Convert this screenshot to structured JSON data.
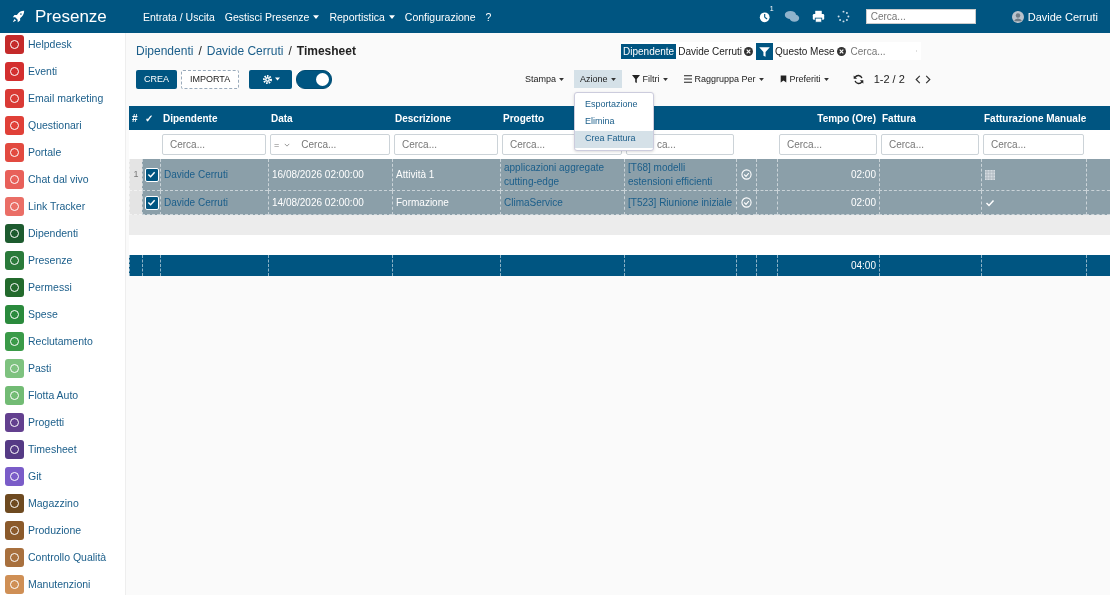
{
  "app": {
    "title": "Presenze",
    "menu": [
      {
        "label": "Entrata / Uscita",
        "dropdown": false
      },
      {
        "label": "Gestisci Presenze",
        "dropdown": true
      },
      {
        "label": "Reportistica",
        "dropdown": true
      },
      {
        "label": "Configurazione",
        "dropdown": false
      },
      {
        "label": "?",
        "dropdown": false
      }
    ],
    "notification_count": "1",
    "search": {
      "placeholder": "Cerca..."
    },
    "user": "Davide Cerruti"
  },
  "sidebar": {
    "items": [
      {
        "label": "Helpdesk",
        "color": "#c42a2a"
      },
      {
        "label": "Eventi",
        "color": "#d32f2f"
      },
      {
        "label": "Email marketing",
        "color": "#d93a35"
      },
      {
        "label": "Questionari",
        "color": "#e04038"
      },
      {
        "label": "Portale",
        "color": "#e24a40"
      },
      {
        "label": "Chat dal vivo",
        "color": "#e8605a"
      },
      {
        "label": "Link Tracker",
        "color": "#ea6e66"
      },
      {
        "label": "Dipendenti",
        "color": "#1d5b2f"
      },
      {
        "label": "Presenze",
        "color": "#2a7a3a"
      },
      {
        "label": "Permessi",
        "color": "#236a2c"
      },
      {
        "label": "Spese",
        "color": "#2a8a3c"
      },
      {
        "label": "Reclutamento",
        "color": "#3a9a48"
      },
      {
        "label": "Pasti",
        "color": "#7ec27f"
      },
      {
        "label": "Flotta Auto",
        "color": "#72bb74"
      },
      {
        "label": "Progetti",
        "color": "#63408f"
      },
      {
        "label": "Timesheet",
        "color": "#553a85"
      },
      {
        "label": "Git",
        "color": "#7a5cc8"
      },
      {
        "label": "Magazzino",
        "color": "#6e4a20"
      },
      {
        "label": "Produzione",
        "color": "#8b5a2b"
      },
      {
        "label": "Controllo Qualità",
        "color": "#a8703e"
      },
      {
        "label": "Manutenzioni",
        "color": "#cf8f55"
      }
    ]
  },
  "breadcrumb": {
    "separator": "/",
    "items": [
      {
        "label": "Dipendenti",
        "current": false
      },
      {
        "label": "Davide Cerruti",
        "current": false
      },
      {
        "label": "Timesheet",
        "current": true
      }
    ]
  },
  "buttons": {
    "create": "CREA",
    "import": "IMPORTA"
  },
  "view_toggle": {
    "on": true
  },
  "search": {
    "facets": [
      {
        "kind": "field",
        "field": "Dipendente",
        "value": "Davide Cerruti"
      },
      {
        "kind": "filter",
        "value": "Questo Mese"
      }
    ],
    "placeholder": "Cerca..."
  },
  "toolbar": [
    {
      "label": "Stampa",
      "kind": "plain",
      "selected": false
    },
    {
      "label": "Azione",
      "kind": "plain",
      "selected": true
    },
    {
      "label": "Filtri",
      "kind": "filter",
      "selected": false
    },
    {
      "label": "Raggruppa Per",
      "kind": "list",
      "selected": false
    },
    {
      "label": "Preferiti",
      "kind": "bookmark",
      "selected": false
    }
  ],
  "pager": "1-2 / 2",
  "action_menu": [
    {
      "label": "Esportazione",
      "selected": false
    },
    {
      "label": "Elimina",
      "selected": false
    },
    {
      "label": "Crea Fattura",
      "selected": true
    }
  ],
  "table": {
    "columns": [
      {
        "label": "#"
      },
      {
        "label": "✓"
      },
      {
        "label": "Dipendente",
        "filter": {
          "placeholder": "Cerca..."
        }
      },
      {
        "label": "Data",
        "filter": {
          "operator": "=",
          "placeholder": "Cerca..."
        }
      },
      {
        "label": "Descrizione",
        "filter": {
          "placeholder": "Cerca..."
        }
      },
      {
        "label": "Progetto",
        "filter": {
          "placeholder": "Cerca..."
        }
      },
      {
        "filter": {
          "placeholder": "ca...",
          "partly_covered": true
        }
      },
      {},
      {},
      {
        "label": "Tempo (Ore)",
        "align_right": true,
        "filter": {
          "placeholder": "Cerca..."
        },
        "total": "04:00"
      },
      {
        "label": "Fattura",
        "filter": {
          "placeholder": "Cerca..."
        }
      },
      {
        "label": "Fatturazione Manuale",
        "filter": {
          "placeholder": "Cerca..."
        }
      },
      {}
    ],
    "rows": [
      {
        "selected": true,
        "cells": [
          {
            "kind": "number",
            "text": "1"
          },
          {
            "kind": "checkbox",
            "checked": true
          },
          {
            "kind": "link",
            "text": "Davide Cerruti"
          },
          {
            "kind": "text",
            "text": "16/08/2026 02:00:00"
          },
          {
            "kind": "text",
            "text": "Attività 1"
          },
          {
            "kind": "link",
            "text": "applicazioni aggregate cutting-edge"
          },
          {
            "kind": "link",
            "text": "[T68] modelli estensioni efficienti"
          },
          {
            "kind": "status",
            "validated": true
          },
          {
            "kind": "empty"
          },
          {
            "kind": "time",
            "text": "02:00"
          },
          {
            "kind": "empty"
          },
          {
            "kind": "billing",
            "mixed": true
          },
          {
            "kind": "empty"
          }
        ]
      },
      {
        "selected": true,
        "cells": [
          {
            "kind": "empty"
          },
          {
            "kind": "checkbox",
            "checked": true
          },
          {
            "kind": "link",
            "text": "Davide Cerruti"
          },
          {
            "kind": "text",
            "text": "14/08/2026 02:00:00"
          },
          {
            "kind": "text",
            "text": "Formazione"
          },
          {
            "kind": "link",
            "text": "ClimaService"
          },
          {
            "kind": "link",
            "text": "[T523] Riunione iniziale"
          },
          {
            "kind": "status",
            "validated": true
          },
          {
            "kind": "empty"
          },
          {
            "kind": "time",
            "text": "02:00"
          },
          {
            "kind": "empty"
          },
          {
            "kind": "billing",
            "checked": true
          },
          {
            "kind": "empty"
          }
        ]
      }
    ]
  }
}
